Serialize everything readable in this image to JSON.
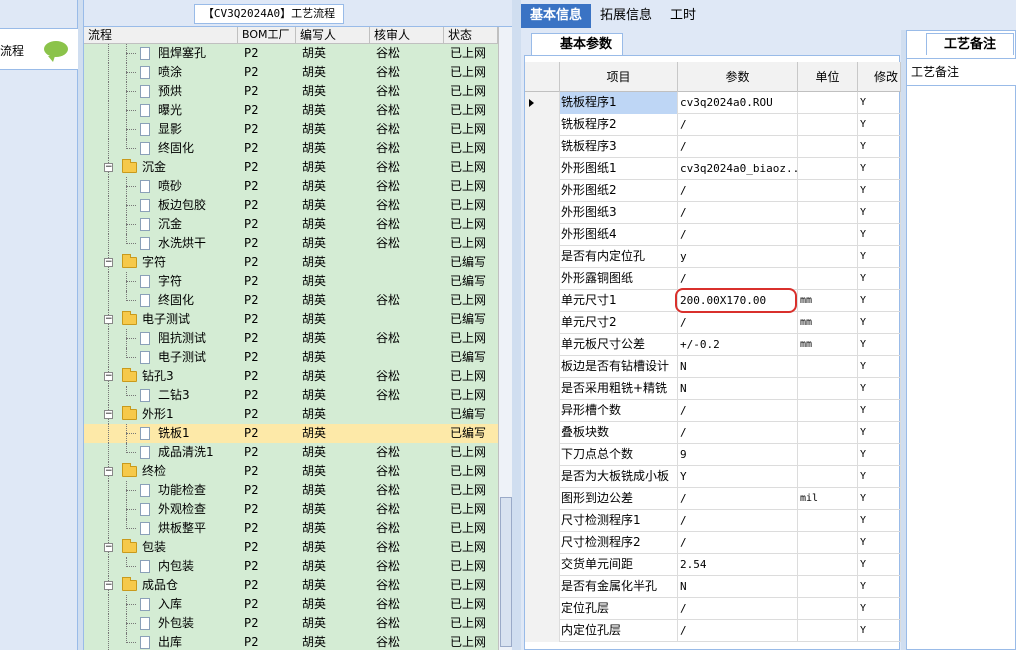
{
  "left_panel": {
    "header_label": "流程"
  },
  "tree_panel": {
    "tab_label": "【CV3Q2024A0】工艺流程",
    "columns": [
      "流程",
      "BOM工厂",
      "编写人",
      "核审人",
      "状态"
    ],
    "rows": [
      {
        "name": "阻焊塞孔",
        "level": 2,
        "bom": "P2",
        "writer": "胡英",
        "reviewer": "谷松",
        "status": "已上网"
      },
      {
        "name": "喷涂",
        "level": 2,
        "bom": "P2",
        "writer": "胡英",
        "reviewer": "谷松",
        "status": "已上网"
      },
      {
        "name": "预烘",
        "level": 2,
        "bom": "P2",
        "writer": "胡英",
        "reviewer": "谷松",
        "status": "已上网"
      },
      {
        "name": "曝光",
        "level": 2,
        "bom": "P2",
        "writer": "胡英",
        "reviewer": "谷松",
        "status": "已上网"
      },
      {
        "name": "显影",
        "level": 2,
        "bom": "P2",
        "writer": "胡英",
        "reviewer": "谷松",
        "status": "已上网"
      },
      {
        "name": "终固化",
        "level": 2,
        "bom": "P2",
        "writer": "胡英",
        "reviewer": "谷松",
        "status": "已上网"
      },
      {
        "name": "沉金",
        "level": 1,
        "bom": "P2",
        "writer": "胡英",
        "reviewer": "谷松",
        "status": "已上网"
      },
      {
        "name": "喷砂",
        "level": 2,
        "bom": "P2",
        "writer": "胡英",
        "reviewer": "谷松",
        "status": "已上网"
      },
      {
        "name": "板边包胶",
        "level": 2,
        "bom": "P2",
        "writer": "胡英",
        "reviewer": "谷松",
        "status": "已上网"
      },
      {
        "name": "沉金",
        "level": 2,
        "bom": "P2",
        "writer": "胡英",
        "reviewer": "谷松",
        "status": "已上网"
      },
      {
        "name": "水洗烘干",
        "level": 2,
        "bom": "P2",
        "writer": "胡英",
        "reviewer": "谷松",
        "status": "已上网"
      },
      {
        "name": "字符",
        "level": 1,
        "bom": "P2",
        "writer": "胡英",
        "reviewer": "",
        "status": "已编写"
      },
      {
        "name": "字符",
        "level": 2,
        "bom": "P2",
        "writer": "胡英",
        "reviewer": "",
        "status": "已编写"
      },
      {
        "name": "终固化",
        "level": 2,
        "bom": "P2",
        "writer": "胡英",
        "reviewer": "谷松",
        "status": "已上网"
      },
      {
        "name": "电子测试",
        "level": 1,
        "bom": "P2",
        "writer": "胡英",
        "reviewer": "",
        "status": "已编写"
      },
      {
        "name": "阻抗测试",
        "level": 2,
        "bom": "P2",
        "writer": "胡英",
        "reviewer": "谷松",
        "status": "已上网"
      },
      {
        "name": "电子测试",
        "level": 2,
        "bom": "P2",
        "writer": "胡英",
        "reviewer": "",
        "status": "已编写"
      },
      {
        "name": "钻孔3",
        "level": 1,
        "bom": "P2",
        "writer": "胡英",
        "reviewer": "谷松",
        "status": "已上网"
      },
      {
        "name": "二钻3",
        "level": 2,
        "bom": "P2",
        "writer": "胡英",
        "reviewer": "谷松",
        "status": "已上网"
      },
      {
        "name": "外形1",
        "level": 1,
        "bom": "P2",
        "writer": "胡英",
        "reviewer": "",
        "status": "已编写"
      },
      {
        "name": "铣板1",
        "level": 2,
        "bom": "P2",
        "writer": "胡英",
        "reviewer": "",
        "status": "已编写",
        "selected": true
      },
      {
        "name": "成品清洗1",
        "level": 2,
        "bom": "P2",
        "writer": "胡英",
        "reviewer": "谷松",
        "status": "已上网"
      },
      {
        "name": "终检",
        "level": 1,
        "bom": "P2",
        "writer": "胡英",
        "reviewer": "谷松",
        "status": "已上网"
      },
      {
        "name": "功能检查",
        "level": 2,
        "bom": "P2",
        "writer": "胡英",
        "reviewer": "谷松",
        "status": "已上网"
      },
      {
        "name": "外观检查",
        "level": 2,
        "bom": "P2",
        "writer": "胡英",
        "reviewer": "谷松",
        "status": "已上网"
      },
      {
        "name": "烘板整平",
        "level": 2,
        "bom": "P2",
        "writer": "胡英",
        "reviewer": "谷松",
        "status": "已上网"
      },
      {
        "name": "包装",
        "level": 1,
        "bom": "P2",
        "writer": "胡英",
        "reviewer": "谷松",
        "status": "已上网"
      },
      {
        "name": "内包装",
        "level": 2,
        "bom": "P2",
        "writer": "胡英",
        "reviewer": "谷松",
        "status": "已上网"
      },
      {
        "name": "成品仓",
        "level": 1,
        "bom": "P2",
        "writer": "胡英",
        "reviewer": "谷松",
        "status": "已上网"
      },
      {
        "name": "入库",
        "level": 2,
        "bom": "P2",
        "writer": "胡英",
        "reviewer": "谷松",
        "status": "已上网"
      },
      {
        "name": "外包装",
        "level": 2,
        "bom": "P2",
        "writer": "胡英",
        "reviewer": "谷松",
        "status": "已上网"
      },
      {
        "name": "出库",
        "level": 2,
        "bom": "P2",
        "writer": "胡英",
        "reviewer": "谷松",
        "status": "已上网"
      }
    ]
  },
  "right_panel": {
    "tabs": [
      "基本信息",
      "拓展信息",
      "工时"
    ],
    "active_tab": 0,
    "subtab_label": "基本参数",
    "grid_columns": [
      "项目",
      "参数",
      "单位",
      "修改"
    ],
    "grid_rows": [
      {
        "item": "铣板程序1",
        "param": "cv3q2024a0.ROU",
        "unit": "",
        "mod": "Y",
        "selected": true
      },
      {
        "item": "铣板程序2",
        "param": "/",
        "unit": "",
        "mod": "Y"
      },
      {
        "item": "铣板程序3",
        "param": "/",
        "unit": "",
        "mod": "Y"
      },
      {
        "item": "外形图纸1",
        "param": "cv3q2024a0_biaoz...",
        "unit": "",
        "mod": "Y"
      },
      {
        "item": "外形图纸2",
        "param": "/",
        "unit": "",
        "mod": "Y"
      },
      {
        "item": "外形图纸3",
        "param": "/",
        "unit": "",
        "mod": "Y"
      },
      {
        "item": "外形图纸4",
        "param": "/",
        "unit": "",
        "mod": "Y"
      },
      {
        "item": "是否有内定位孔",
        "param": "y",
        "unit": "",
        "mod": "Y"
      },
      {
        "item": "外形露铜图纸",
        "param": "/",
        "unit": "",
        "mod": "Y"
      },
      {
        "item": "单元尺寸1",
        "param": "200.00X170.00",
        "unit": "mm",
        "mod": "Y",
        "highlighted": true
      },
      {
        "item": "单元尺寸2",
        "param": "/",
        "unit": "mm",
        "mod": "Y"
      },
      {
        "item": "单元板尺寸公差",
        "param": "+/-0.2",
        "unit": "mm",
        "mod": "Y"
      },
      {
        "item": "板边是否有钻槽设计",
        "param": "N",
        "unit": "",
        "mod": "Y"
      },
      {
        "item": "是否采用粗铣+精铣",
        "param": "N",
        "unit": "",
        "mod": "Y"
      },
      {
        "item": "异形槽个数",
        "param": "/",
        "unit": "",
        "mod": "Y"
      },
      {
        "item": "叠板块数",
        "param": "/",
        "unit": "",
        "mod": "Y"
      },
      {
        "item": "下刀点总个数",
        "param": "9",
        "unit": "",
        "mod": "Y"
      },
      {
        "item": "是否为大板铣成小板",
        "param": "Y",
        "unit": "",
        "mod": "Y"
      },
      {
        "item": "图形到边公差",
        "param": "/",
        "unit": "mil",
        "mod": "Y"
      },
      {
        "item": "尺寸检测程序1",
        "param": "/",
        "unit": "",
        "mod": "Y"
      },
      {
        "item": "尺寸检测程序2",
        "param": "/",
        "unit": "",
        "mod": "Y"
      },
      {
        "item": "交货单元间距",
        "param": "2.54",
        "unit": "",
        "mod": "Y"
      },
      {
        "item": "是否有金属化半孔",
        "param": "N",
        "unit": "",
        "mod": "Y"
      },
      {
        "item": "定位孔层",
        "param": "/",
        "unit": "",
        "mod": "Y"
      },
      {
        "item": "内定位孔层",
        "param": "/",
        "unit": "",
        "mod": "Y"
      }
    ]
  },
  "notes_panel": {
    "tab_label": "工艺备注",
    "header_label": "工艺备注"
  },
  "colors": {
    "tree_row_bg": "#d4ecd4",
    "tree_selected_bg": "#fde9a8",
    "tab_active_bg": "#3a73c4",
    "highlight_ring": "#d9302c",
    "panel_bg": "#dfe8f6"
  }
}
